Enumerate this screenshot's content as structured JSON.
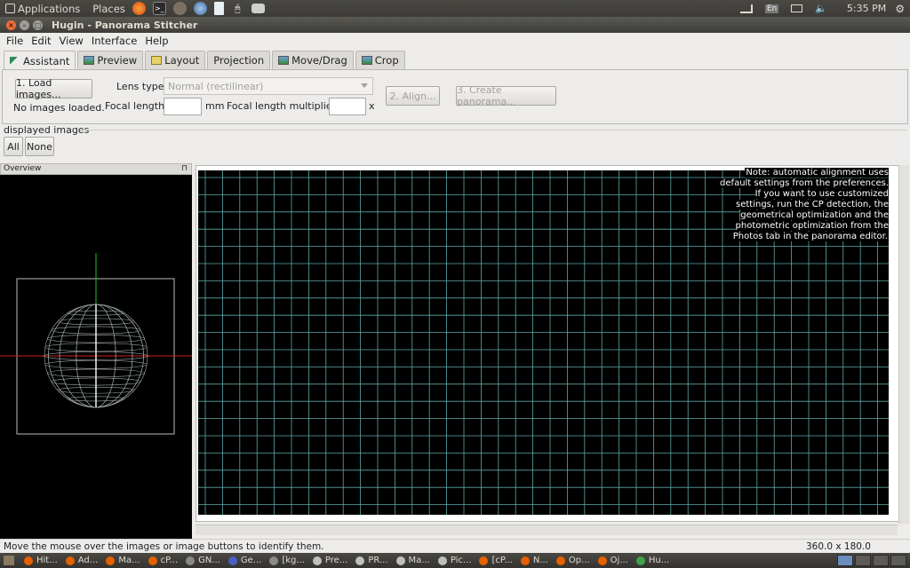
{
  "top_panel": {
    "applications": "Applications",
    "places": "Places",
    "lang": "En",
    "clock": "5:35 PM",
    "icons": [
      "firefox-icon",
      "terminal-icon",
      "gimp-icon",
      "network-globe-icon",
      "document-icon",
      "mouse-icon",
      "printer-icon"
    ]
  },
  "window": {
    "title": "Hugin - Panorama Stitcher"
  },
  "menu": [
    "File",
    "Edit",
    "View",
    "Interface",
    "Help"
  ],
  "tabs": [
    {
      "label": "Assistant",
      "icon_color": "#2e8b57"
    },
    {
      "label": "Preview",
      "icon_color": "#3b6fb6"
    },
    {
      "label": "Layout",
      "icon_color": "#c8a000"
    },
    {
      "label": "Projection",
      "icon_color": ""
    },
    {
      "label": "Move/Drag",
      "icon_color": "#3b6fb6"
    },
    {
      "label": "Crop",
      "icon_color": "#3b6fb6"
    }
  ],
  "assistant": {
    "load_button": "1. Load images...",
    "status": "No images loaded.",
    "lens_type_label": "Lens type:",
    "lens_type_value": "Normal (rectilinear)",
    "focal_length_label": "Focal length:",
    "focal_length_value": "",
    "mm": "mm",
    "multiplier_label": "Focal length multiplier:",
    "multiplier_value": "",
    "x": "x",
    "align_button": "2. Align...",
    "create_button": "3. Create panorama..."
  },
  "displayed_images": {
    "label": "displayed images",
    "all": "All",
    "none": "None"
  },
  "overview": {
    "title": "Overview"
  },
  "preview": {
    "note": "Note: automatic alignment uses default settings from the preferences. If you want to use customized settings, run the CP detection, the geometrical optimization and the photometric optimization from the Photos tab in the panorama editor.",
    "grid_color": "#5ea8a8"
  },
  "statusbar": {
    "message": "Move the mouse over the images or image buttons to identify them.",
    "coords": "360.0 x 180.0"
  },
  "taskbar": {
    "tasks": [
      {
        "label": "Hit...",
        "color": "#e66000"
      },
      {
        "label": "Ad...",
        "color": "#e66000"
      },
      {
        "label": "Ma...",
        "color": "#e66000"
      },
      {
        "label": "cP...",
        "color": "#e66000"
      },
      {
        "label": "GN...",
        "color": "#8a8a8a"
      },
      {
        "label": "Ge...",
        "color": "#4a5fc1"
      },
      {
        "label": "[kg...",
        "color": "#8a8a8a"
      },
      {
        "label": "Pre...",
        "color": "#bfbfbf"
      },
      {
        "label": "PR...",
        "color": "#bfbfbf"
      },
      {
        "label": "Ma...",
        "color": "#bfbfbf"
      },
      {
        "label": "Pic...",
        "color": "#bfbfbf"
      },
      {
        "label": "[cP...",
        "color": "#e66000"
      },
      {
        "label": "N...",
        "color": "#e66000"
      },
      {
        "label": "Op...",
        "color": "#e66000"
      },
      {
        "label": "Oj...",
        "color": "#e66000"
      },
      {
        "label": "Hu...",
        "color": "#3fa34d"
      }
    ]
  }
}
